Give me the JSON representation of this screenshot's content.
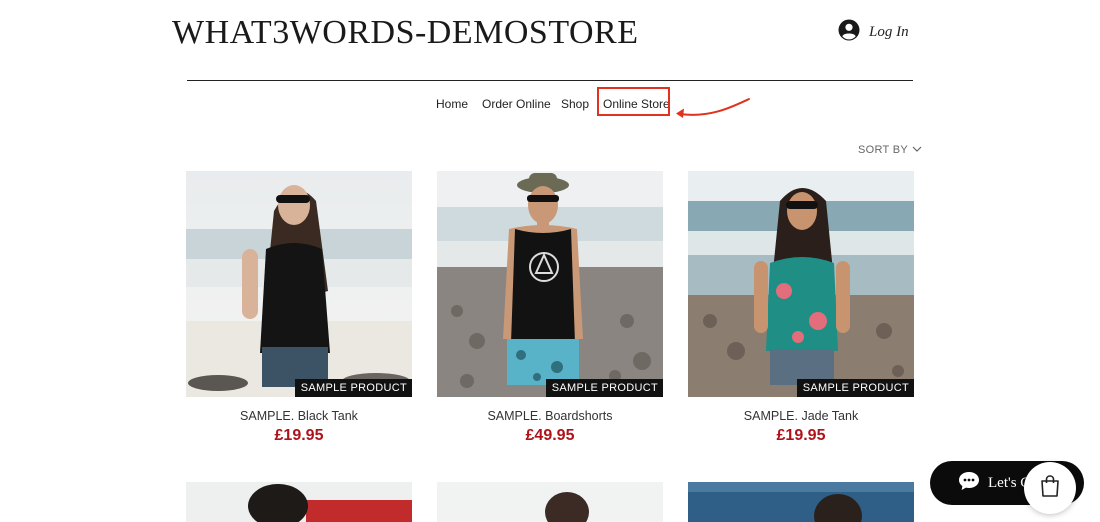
{
  "header": {
    "site_title": "WHAT3WORDS-DEMOSTORE",
    "login_label": "Log In"
  },
  "nav": {
    "items": [
      {
        "label": "Home"
      },
      {
        "label": "Order Online"
      },
      {
        "label": "Shop"
      },
      {
        "label": "Online Store"
      }
    ],
    "highlighted_item": "Online Store"
  },
  "sort": {
    "label": "SORT BY"
  },
  "products": [
    {
      "name": "SAMPLE. Black Tank",
      "price": "£19.95",
      "badge": "SAMPLE PRODUCT"
    },
    {
      "name": "SAMPLE. Boardshorts",
      "price": "£49.95",
      "badge": "SAMPLE PRODUCT"
    },
    {
      "name": "SAMPLE. Jade Tank",
      "price": "£19.95",
      "badge": "SAMPLE PRODUCT"
    }
  ],
  "chat": {
    "label": "Let's Chat!"
  },
  "colors": {
    "price": "#b0121a",
    "highlight": "#e0321f",
    "chat_bg": "#0b0b0b"
  },
  "icons": {
    "login": "user-circle-icon",
    "chat": "chat-bubble-icon",
    "cart": "shopping-bag-icon",
    "sort": "chevron-down-icon"
  }
}
